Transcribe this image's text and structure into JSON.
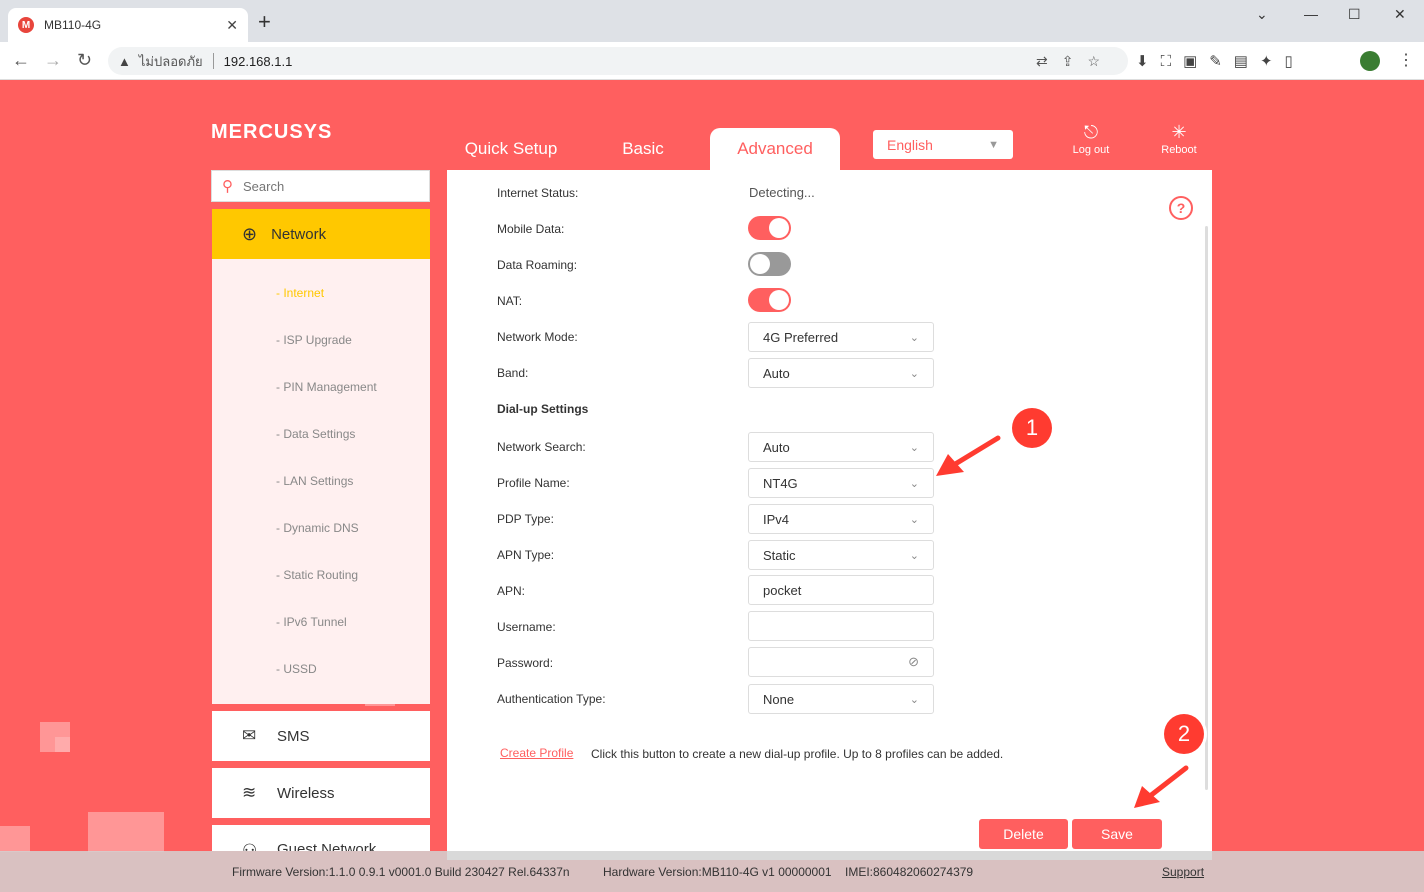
{
  "browser": {
    "tab_title": "MB110-4G",
    "favicon_letter": "M",
    "insecure_label": "ไม่ปลอดภัย",
    "url": "192.168.1.1"
  },
  "header": {
    "logo": "MERCUSYS",
    "tabs": [
      {
        "label": "Quick Setup"
      },
      {
        "label": "Basic"
      },
      {
        "label": "Advanced"
      }
    ],
    "language": "English",
    "logout_label": "Log out",
    "reboot_label": "Reboot"
  },
  "sidebar": {
    "search_placeholder": "Search",
    "network_label": "Network",
    "submenu": [
      "- Internet",
      "- ISP Upgrade",
      "- PIN Management",
      "- Data Settings",
      "- LAN Settings",
      "- Dynamic DNS",
      "- Static Routing",
      "- IPv6 Tunnel",
      "- USSD"
    ],
    "sms_label": "SMS",
    "wireless_label": "Wireless",
    "guest_label": "Guest Network"
  },
  "panel": {
    "internet_status_label": "Internet Status:",
    "internet_status_value": "Detecting...",
    "mobile_data_label": "Mobile Data:",
    "mobile_data_on": true,
    "roaming_label": "Data Roaming:",
    "roaming_on": false,
    "nat_label": "NAT:",
    "nat_on": true,
    "network_mode_label": "Network Mode:",
    "network_mode_value": "4G Preferred",
    "band_label": "Band:",
    "band_value": "Auto",
    "dialup_title": "Dial-up Settings",
    "network_search_label": "Network Search:",
    "network_search_value": "Auto",
    "profile_name_label": "Profile Name:",
    "profile_name_value": "NT4G",
    "pdp_type_label": "PDP Type:",
    "pdp_type_value": "IPv4",
    "apn_type_label": "APN Type:",
    "apn_type_value": "Static",
    "apn_label": "APN:",
    "apn_value": "pocket",
    "username_label": "Username:",
    "username_value": "",
    "password_label": "Password:",
    "password_value": "",
    "auth_type_label": "Authentication Type:",
    "auth_type_value": "None",
    "create_profile_label": "Create Profile",
    "create_profile_desc": "Click this button to create a new dial-up profile. Up to 8 profiles can be added.",
    "delete_label": "Delete",
    "save_label": "Save"
  },
  "annotations": {
    "badge1": "1",
    "badge2": "2"
  },
  "footer": {
    "firmware": "Firmware Version:1.1.0 0.9.1 v0001.0 Build 230427 Rel.64337n",
    "hardware": "Hardware Version:MB110-4G v1 00000001",
    "imei": "IMEI:860482060274379",
    "support": "Support"
  },
  "colors": {
    "brand": "#ff5f5f",
    "accent": "#ffc800"
  }
}
